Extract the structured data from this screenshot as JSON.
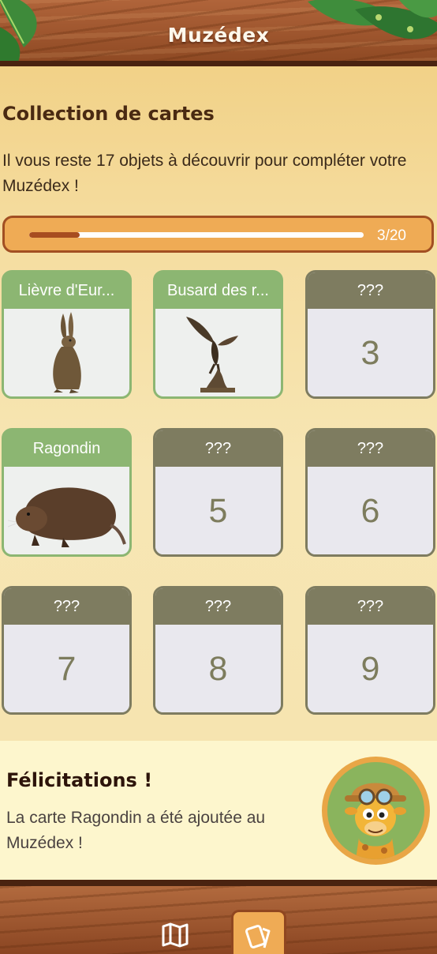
{
  "app": {
    "title": "Muzédex"
  },
  "collection": {
    "title": "Collection de cartes",
    "description": "Il vous reste 17 objets à découvrir pour compléter votre Muzédex !",
    "progress": {
      "label": "3/20",
      "found": 3,
      "total": 20
    }
  },
  "cards": [
    {
      "caption": "Lièvre d'Eur...",
      "number": "",
      "found": true,
      "image": "hare"
    },
    {
      "caption": "Busard des r...",
      "number": "",
      "found": true,
      "image": "bird-of-prey"
    },
    {
      "caption": "???",
      "number": "3",
      "found": false
    },
    {
      "caption": "Ragondin",
      "number": "",
      "found": true,
      "image": "coypu"
    },
    {
      "caption": "???",
      "number": "5",
      "found": false
    },
    {
      "caption": "???",
      "number": "6",
      "found": false
    },
    {
      "caption": "???",
      "number": "7",
      "found": false
    },
    {
      "caption": "???",
      "number": "8",
      "found": false
    },
    {
      "caption": "???",
      "number": "9",
      "found": false
    }
  ],
  "banner": {
    "title": "Félicitations !",
    "text": "La carte Ragondin a été ajoutée au Muzédex !",
    "avatar": "giraffe-explorer"
  },
  "nav": {
    "items": [
      {
        "icon": "map-icon",
        "active": false
      },
      {
        "icon": "cards-icon",
        "active": true
      }
    ]
  },
  "colors": {
    "accent": "#efab55",
    "found": "#8cb672",
    "locked": "#7e7c60",
    "progress_fill": "#a84d20",
    "wood": "#8f4a24"
  }
}
